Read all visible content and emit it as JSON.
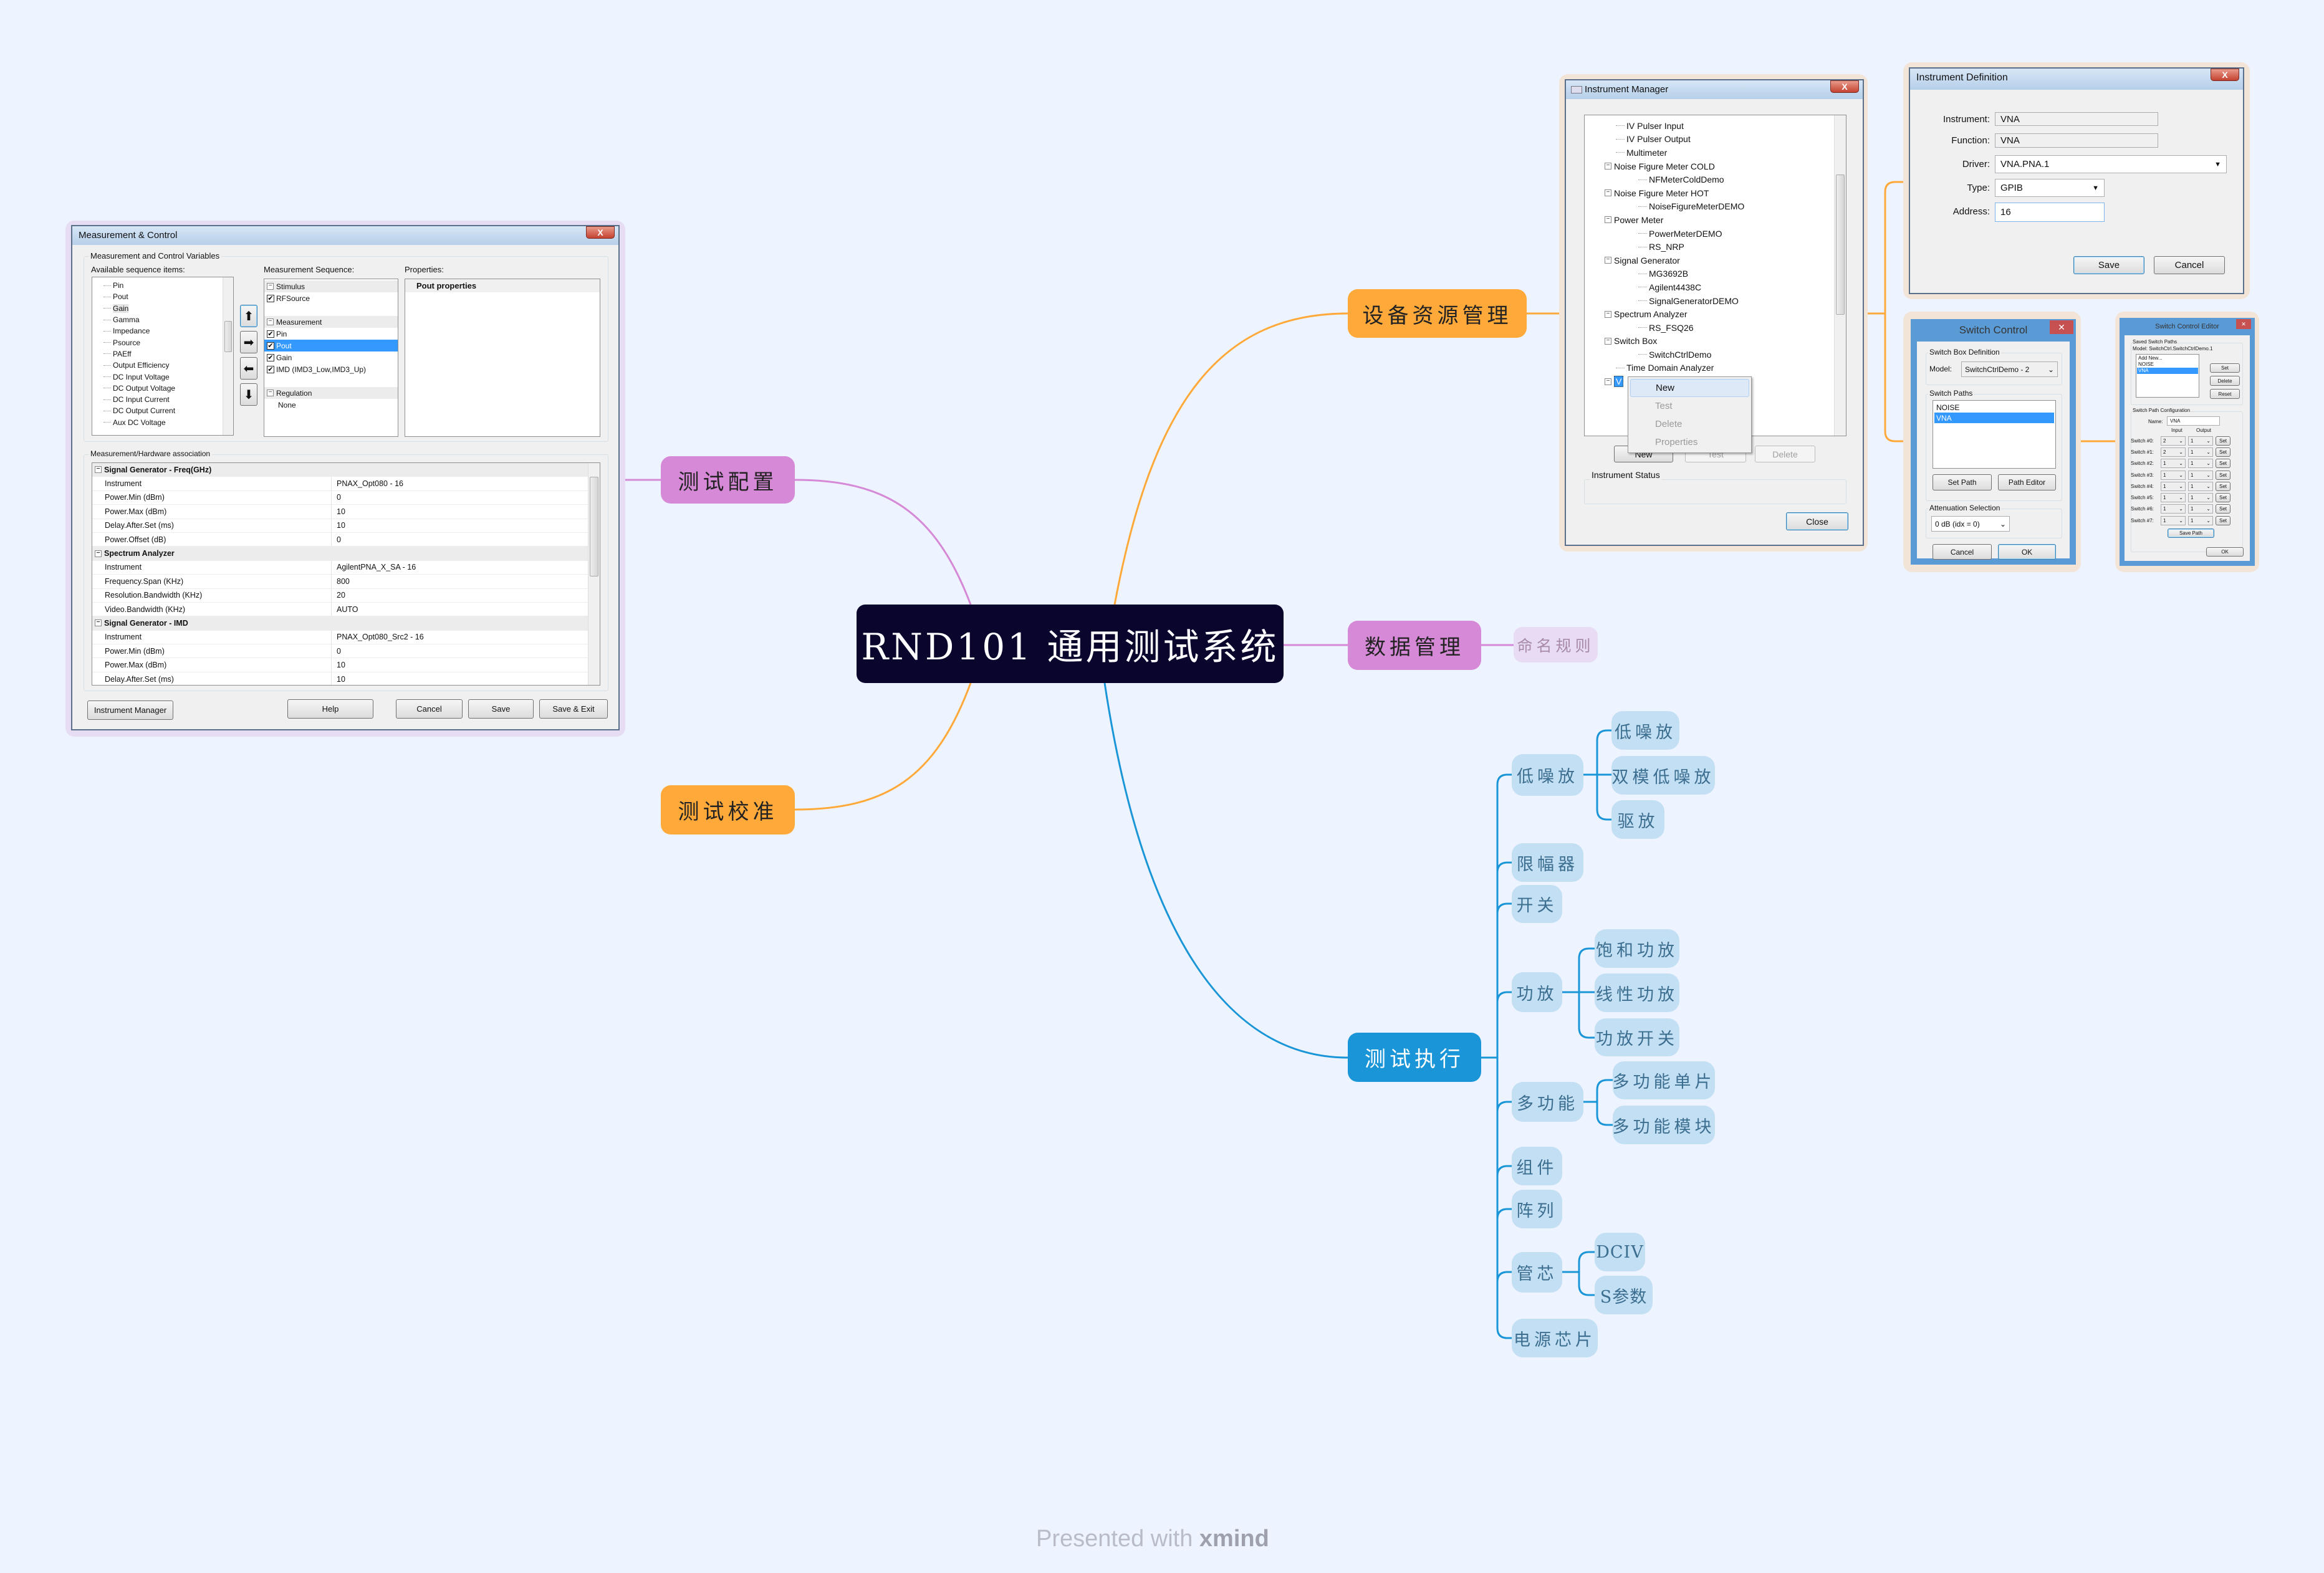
{
  "colors": {
    "background": "#eef4ff",
    "central": "#0a052c",
    "orange": "#ffa93a",
    "purple": "#d589d6",
    "blue": "#1a96d8",
    "sub_blue": "#c3dff4",
    "naming": "#e8dcf4"
  },
  "mindmap": {
    "central": "RND101  通用测试系统",
    "branches": {
      "config": "测试配置",
      "calib": "测试校准",
      "device": "设备资源管理",
      "data": "数据管理",
      "exec": "测试执行"
    },
    "data_children": [
      "命名规则"
    ],
    "exec_children": {
      "lna": {
        "label": "低噪放",
        "children": [
          "低噪放",
          "双模低噪放",
          "驱放"
        ]
      },
      "limiter": {
        "label": "限幅器"
      },
      "switch": {
        "label": "开关"
      },
      "pa": {
        "label": "功放",
        "children": [
          "饱和功放",
          "线性功放",
          "功放开关"
        ]
      },
      "multi": {
        "label": "多功能",
        "children": [
          "多功能单片",
          "多功能模块"
        ]
      },
      "module": {
        "label": "组件"
      },
      "array": {
        "label": "阵列"
      },
      "die": {
        "label": "管芯",
        "children": [
          "DCIV",
          "S参数"
        ]
      },
      "power": {
        "label": "电源芯片"
      }
    }
  },
  "measurement_control": {
    "title": "Measurement & Control",
    "close": "X",
    "vars_group": "Measurement and Control Variables",
    "available_label": "Available sequence items:",
    "available_items": [
      "Pin",
      "Pout",
      "Gain",
      "Gamma",
      "Impedance",
      "Psource",
      "PAEff",
      "Output Efficiency",
      "DC Input Voltage",
      "DC Output Voltage",
      "DC Input Current",
      "DC Output Current",
      "Aux DC Voltage"
    ],
    "available_highlighted": "Gain",
    "sequence_label": "Measurement Sequence:",
    "sequence": [
      {
        "type": "header",
        "label": "Stimulus"
      },
      {
        "type": "check",
        "label": "RFSource",
        "checked": true
      },
      {
        "type": "blank",
        "label": ""
      },
      {
        "type": "header",
        "label": "Measurement"
      },
      {
        "type": "check",
        "label": "Pin",
        "checked": true
      },
      {
        "type": "check",
        "label": "Pout",
        "checked": true,
        "selected": true
      },
      {
        "type": "check",
        "label": "Gain",
        "checked": true
      },
      {
        "type": "check",
        "label": "IMD (IMD3_Low,IMD3_Up)",
        "checked": true
      },
      {
        "type": "blank",
        "label": ""
      },
      {
        "type": "header",
        "label": "Regulation"
      },
      {
        "type": "text",
        "label": "None"
      }
    ],
    "properties_label": "Properties:",
    "properties_title": "Pout properties",
    "association_group": "Measurement/Hardware association",
    "association": [
      {
        "type": "header",
        "label": "Signal Generator - Freq(GHz)"
      },
      {
        "label": "Instrument",
        "value": "PNAX_Opt080 - 16"
      },
      {
        "label": "Power.Min (dBm)",
        "value": "0"
      },
      {
        "label": "Power.Max (dBm)",
        "value": "10"
      },
      {
        "label": "Delay.After.Set (ms)",
        "value": "10"
      },
      {
        "label": "Power.Offset (dB)",
        "value": "0"
      },
      {
        "type": "header",
        "label": "Spectrum Analyzer"
      },
      {
        "label": "Instrument",
        "value": "AgilentPNA_X_SA - 16"
      },
      {
        "label": "Frequency.Span (KHz)",
        "value": "800"
      },
      {
        "label": "Resolution.Bandwidth (KHz)",
        "value": "20"
      },
      {
        "label": "Video.Bandwidth (KHz)",
        "value": "AUTO"
      },
      {
        "type": "header",
        "label": "Signal Generator - IMD"
      },
      {
        "label": "Instrument",
        "value": "PNAX_Opt080_Src2 - 16"
      },
      {
        "label": "Power.Min (dBm)",
        "value": "0"
      },
      {
        "label": "Power.Max (dBm)",
        "value": "10"
      },
      {
        "label": "Delay.After.Set (ms)",
        "value": "10"
      }
    ],
    "buttons": {
      "instrument_manager": "Instrument Manager",
      "help": "Help",
      "cancel": "Cancel",
      "save": "Save",
      "save_exit": "Save & Exit"
    }
  },
  "instrument_manager": {
    "title": "Instrument Manager",
    "close": "X",
    "tree": [
      {
        "label": "IV Pulser Input",
        "children": []
      },
      {
        "label": "IV Pulser Output",
        "children": []
      },
      {
        "label": "Multimeter",
        "children": []
      },
      {
        "label": "Noise Figure Meter COLD",
        "children": [
          "NFMeterColdDemo"
        ]
      },
      {
        "label": "Noise Figure Meter HOT",
        "children": [
          "NoiseFigureMeterDEMO"
        ]
      },
      {
        "label": "Power Meter",
        "children": [
          "PowerMeterDEMO",
          "RS_NRP"
        ]
      },
      {
        "label": "Signal Generator",
        "children": [
          "MG3692B",
          "Agilent4438C",
          "SignalGeneratorDEMO"
        ]
      },
      {
        "label": "Spectrum Analyzer",
        "children": [
          "RS_FSQ26"
        ]
      },
      {
        "label": "Switch Box",
        "children": [
          "SwitchCtrlDemo"
        ]
      },
      {
        "label": "Time Domain Analyzer",
        "children": []
      },
      {
        "label": "V",
        "children": [],
        "selected": true
      }
    ],
    "context_menu": [
      {
        "label": "New",
        "enabled": true,
        "hover": true
      },
      {
        "label": "Test",
        "enabled": false
      },
      {
        "label": "Delete",
        "enabled": false
      },
      {
        "label": "Properties",
        "enabled": false
      }
    ],
    "buttons": {
      "new": "New",
      "test": "Test",
      "delete": "Delete",
      "close": "Close"
    },
    "status_label": "Instrument Status"
  },
  "instrument_definition": {
    "title": "Instrument Definition",
    "close": "X",
    "fields": {
      "instrument": {
        "label": "Instrument:",
        "value": "VNA"
      },
      "function": {
        "label": "Function:",
        "value": "VNA"
      },
      "driver": {
        "label": "Driver:",
        "value": "VNA.PNA.1"
      },
      "type": {
        "label": "Type:",
        "value": "GPIB"
      },
      "address": {
        "label": "Address:",
        "value": "16"
      }
    },
    "buttons": {
      "save": "Save",
      "cancel": "Cancel"
    }
  },
  "switch_control": {
    "title": "Switch Control",
    "close": "✕",
    "box_group": "Switch Box Definition",
    "model_label": "Model:",
    "model_value": "SwitchCtrlDemo - 2",
    "paths_group": "Switch Paths",
    "paths": [
      "NOISE",
      "VNA"
    ],
    "selected_path": "VNA",
    "buttons": {
      "set_path": "Set Path",
      "path_editor": "Path Editor",
      "cancel": "Cancel",
      "ok": "OK"
    },
    "atten_group": "Attenuation Selection",
    "atten_value": "0 dB (idx = 0)"
  },
  "switch_control_editor": {
    "title": "Switch Control Editor",
    "close": "✕",
    "saved_group": "Saved Switch Paths",
    "model_line": "Model:  SwitchCtrl.SwitchCtrlDemo.1",
    "saved": [
      "Add New...",
      "NOISE",
      "VNA"
    ],
    "selected_saved": "VNA",
    "buttons": {
      "set": "Set",
      "delete": "Delete",
      "reset": "Reset",
      "save_path": "Save Path",
      "ok": "OK"
    },
    "config_group": "Switch Path Configuration",
    "name_label": "Name:",
    "name_value": "VNA",
    "input_header": "Input",
    "output_header": "Output",
    "switches": [
      {
        "label": "Switch #0:",
        "input": "2",
        "output": "1",
        "set": "Set"
      },
      {
        "label": "Switch #1:",
        "input": "2",
        "output": "1",
        "set": "Set"
      },
      {
        "label": "Switch #2:",
        "input": "1",
        "output": "1",
        "set": "Set"
      },
      {
        "label": "Switch #3:",
        "input": "1",
        "output": "1",
        "set": "Set"
      },
      {
        "label": "Switch #4:",
        "input": "1",
        "output": "1",
        "set": "Set"
      },
      {
        "label": "Switch #5:",
        "input": "1",
        "output": "1",
        "set": "Set"
      },
      {
        "label": "Switch #6:",
        "input": "1",
        "output": "1",
        "set": "Set"
      },
      {
        "label": "Switch #7:",
        "input": "1",
        "output": "1",
        "set": "Set"
      }
    ]
  },
  "footer": {
    "presented_with": "Presented with ",
    "brand": "xmind"
  }
}
